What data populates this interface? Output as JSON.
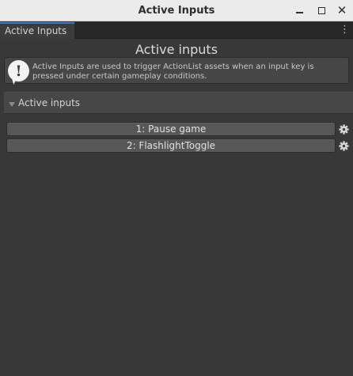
{
  "window": {
    "title": "Active Inputs",
    "controls": {
      "minimize": "minimize-icon",
      "maximize": "maximize-icon",
      "close": "✕"
    }
  },
  "tab": {
    "label": "Active Inputs",
    "menu_icon": "⋮"
  },
  "page": {
    "title": "Active inputs"
  },
  "help": {
    "icon": "!",
    "text": "Active Inputs are used to trigger ActionList assets when an input key is pressed under certain gameplay conditions."
  },
  "section": {
    "label": "Active inputs"
  },
  "items": [
    {
      "label": "1: Pause game",
      "icon": "gear-icon"
    },
    {
      "label": "2: FlashlightToggle",
      "icon": "gear-icon"
    }
  ],
  "colors": {
    "background": "#383838",
    "titlebar": "#ebebeb",
    "tab_accent": "#3a79bb",
    "button": "#575757"
  }
}
